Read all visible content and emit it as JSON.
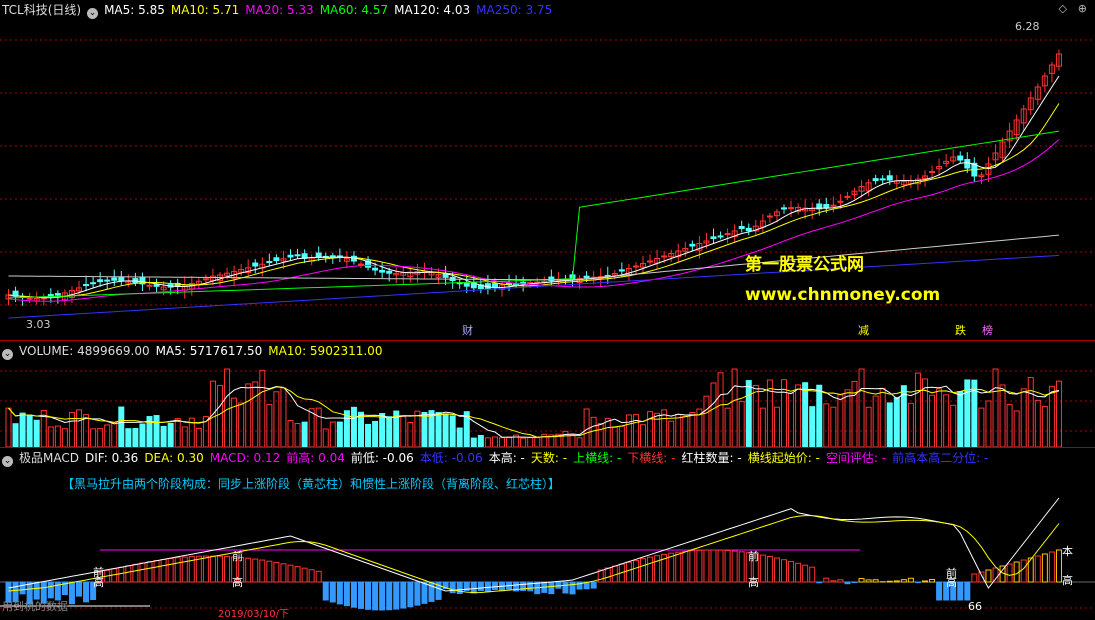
{
  "price": {
    "stock_name": "TCL科技(日线)",
    "indicators": [
      {
        "text": "MA5: 5.85",
        "color": "#ffffff"
      },
      {
        "text": "MA10: 5.71",
        "color": "#ffff00"
      },
      {
        "text": "MA20: 5.33",
        "color": "#ff00ff"
      },
      {
        "text": "MA60: 4.57",
        "color": "#00ff00"
      },
      {
        "text": "MA120: 4.03",
        "color": "#ffffff"
      },
      {
        "text": "MA250: 3.75",
        "color": "#3333ff"
      }
    ],
    "high_label": "6.28",
    "low_label": "3.03",
    "event_tags": [
      "财",
      "减",
      "跌",
      "榜"
    ]
  },
  "watermark": {
    "line1": "第一股票公式网",
    "line2": "www.chnmoney.com"
  },
  "volume": {
    "title": "VOLUME: 4899669.00",
    "ma5": "MA5: 5717617.50",
    "ma10": "MA10: 5902311.00"
  },
  "macd": {
    "title": "极品MACD",
    "fields": [
      {
        "text": "DIF: 0.36",
        "color": "#ffffff"
      },
      {
        "text": "DEA: 0.30",
        "color": "#ffff00"
      },
      {
        "text": "MACD: 0.12",
        "color": "#ff00ff"
      },
      {
        "text": "前高: 0.04",
        "color": "#ff00ff"
      },
      {
        "text": "前低: -0.06",
        "color": "#ffffff"
      },
      {
        "text": "本低: -0.06",
        "color": "#3333ff"
      },
      {
        "text": "本高: -",
        "color": "#ffffff"
      },
      {
        "text": "天数: -",
        "color": "#ffff00"
      },
      {
        "text": "上横线: -",
        "color": "#00ff00"
      },
      {
        "text": "下横线: -",
        "color": "#ff3333"
      },
      {
        "text": "红柱数量: -",
        "color": "#ffffff"
      },
      {
        "text": "横线起始价: -",
        "color": "#ffff00"
      },
      {
        "text": "空间评估: -",
        "color": "#ff00ff"
      },
      {
        "text": "前高本高二分位: -",
        "color": "#3333ff"
      }
    ],
    "description": "【黑马拉升由两个阶段构成：同步上涨阶段（黄芯柱）和惯性上涨阶段（背离阶段、红芯柱）】",
    "markers": [
      "前",
      "高",
      "前",
      "高",
      "前",
      "高",
      "前",
      "高",
      "本",
      "高",
      "66"
    ],
    "bottom_note": "用到机的数据",
    "axis_date": "2019/03/10/下"
  },
  "colors": {
    "up": "#ff3232",
    "down": "#54ffff",
    "grid": "#aa0000"
  }
}
